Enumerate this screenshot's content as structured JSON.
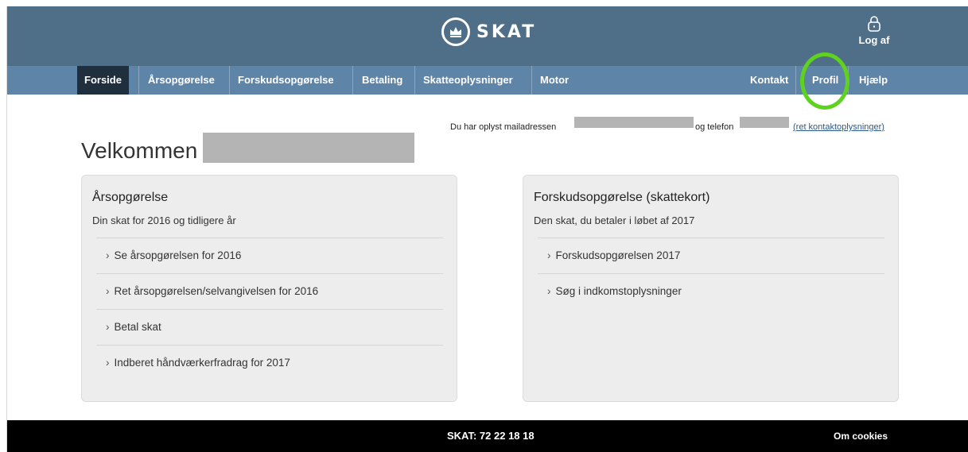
{
  "header": {
    "logo_text": "SKAT",
    "logout_label": "Log af"
  },
  "nav": {
    "items": [
      {
        "label": "Forside"
      },
      {
        "label": "Årsopgørelse"
      },
      {
        "label": "Forskudsopgørelse"
      },
      {
        "label": "Betaling"
      },
      {
        "label": "Skatteoplysninger"
      },
      {
        "label": "Motor"
      },
      {
        "label": "Kontakt"
      },
      {
        "label": "Profil"
      },
      {
        "label": "Hjælp"
      }
    ],
    "active": "Forside",
    "highlighted": "Profil",
    "highlight_color": "#5fd11f"
  },
  "contact": {
    "email_prefix": "Du har oplyst mailadressen",
    "phone_prefix": "og telefon",
    "edit_link": "(ret kontaktoplysninger)"
  },
  "welcome": {
    "text": "Velkommen"
  },
  "cards": {
    "aarsopgoerelse": {
      "title": "Årsopgørelse",
      "subtitle": "Din skat for 2016 og tidligere år",
      "links": [
        "Se årsopgørelsen for 2016",
        "Ret årsopgørelsen/selvangivelsen for 2016",
        "Betal skat",
        "Indberet håndværkerfradrag for 2017"
      ]
    },
    "forskud": {
      "title": "Forskudsopgørelse (skattekort)",
      "subtitle": "Den skat, du betaler i løbet af 2017",
      "links": [
        "Forskudsopgørelsen 2017",
        "Søg i indkomstoplysninger"
      ]
    }
  },
  "footer": {
    "phone": "SKAT: 72 22 18 18",
    "cookies": "Om cookies"
  },
  "colors": {
    "topbar": "#4f6e88",
    "navbar": "#5e84a8",
    "nav_active": "#1f2f3e",
    "footer": "#000000"
  }
}
